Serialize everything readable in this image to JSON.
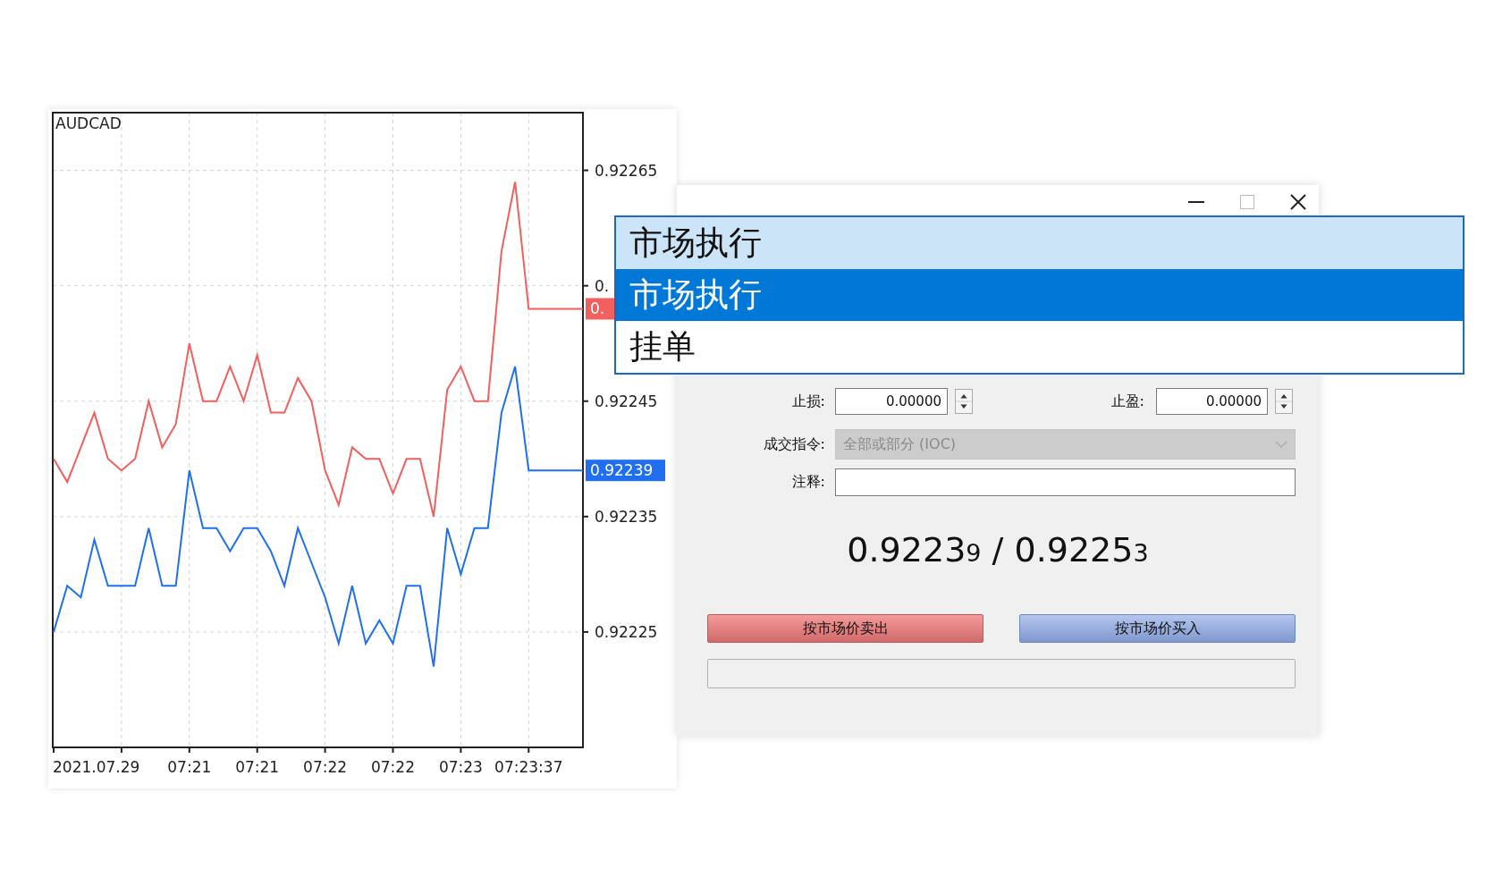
{
  "chart_window": {
    "symbol": "AUDCAD",
    "chart_data": {
      "type": "line",
      "ylim": [
        0.92215,
        0.9227
      ],
      "grid": true,
      "categories": [
        null,
        null,
        null,
        null,
        null,
        null,
        null,
        null,
        null,
        null,
        "07:21",
        null,
        null,
        null,
        null,
        "07:21",
        null,
        null,
        null,
        null,
        "07:22",
        null,
        null,
        null,
        null,
        "07:22",
        null,
        null,
        null,
        null,
        "07:23",
        null,
        null,
        null,
        null,
        "07:23:37",
        null,
        null,
        null,
        null
      ],
      "yticks": [
        0.92225,
        0.92235,
        0.92245,
        0.92265
      ],
      "series": [
        {
          "color": "#f25f5f",
          "values": [
            0.9224,
            0.92238,
            0.92241,
            0.92244,
            0.9224,
            0.92239,
            0.9224,
            0.92245,
            0.92241,
            0.92243,
            0.9225,
            0.92245,
            0.92245,
            0.92248,
            0.92245,
            0.92249,
            0.92244,
            0.92244,
            0.92247,
            0.92245,
            0.92239,
            0.92236,
            0.92241,
            0.9224,
            0.9224,
            0.92237,
            0.9224,
            0.9224,
            0.92235,
            0.92246,
            0.92248,
            0.92245,
            0.92245,
            0.92258,
            0.92264,
            0.92253,
            0.92253,
            0.92253,
            0.92253,
            0.92253
          ]
        },
        {
          "color": "#1f6ff0",
          "values": [
            0.92225,
            0.92229,
            0.92228,
            0.92233,
            0.92229,
            0.92229,
            0.92229,
            0.92234,
            0.92229,
            0.92229,
            0.92239,
            0.92234,
            0.92234,
            0.92232,
            0.92234,
            0.92234,
            0.92232,
            0.92229,
            0.92234,
            0.92231,
            0.92228,
            0.92224,
            0.92229,
            0.92224,
            0.92226,
            0.92224,
            0.92229,
            0.92229,
            0.92222,
            0.92234,
            0.9223,
            0.92234,
            0.92234,
            0.92244,
            0.92248,
            0.92239,
            0.92239,
            0.92239,
            0.92239,
            0.92239
          ]
        }
      ]
    },
    "start_date": "2021.07.29",
    "covered_axis_label": "0.",
    "price_tags": [
      {
        "label": "0.",
        "color": "#f25f5f"
      },
      {
        "label": "0.92239",
        "color": "#1f6ff0"
      }
    ]
  },
  "order_window": {
    "execution_list": [
      {
        "label": "市场执行",
        "selected": false,
        "highlighted": true
      },
      {
        "label": "市场执行",
        "selected": true,
        "highlighted": false
      },
      {
        "label": "挂单",
        "selected": false,
        "highlighted": false
      }
    ],
    "stop_loss": {
      "label": "止损:",
      "value": "0.00000"
    },
    "take_profit": {
      "label": "止盈:",
      "value": "0.00000"
    },
    "fill_policy": {
      "label": "成交指令:",
      "value": "全部或部分 (IOC)",
      "disabled": true
    },
    "comment": {
      "label": "注释:"
    },
    "quote": {
      "bid": "0.9223",
      "bid_pip": "9",
      "separator": "/",
      "ask": "0.9225",
      "ask_pip": "3"
    },
    "sell_button": "按市场价卖出",
    "buy_button": "按市场价买入"
  }
}
